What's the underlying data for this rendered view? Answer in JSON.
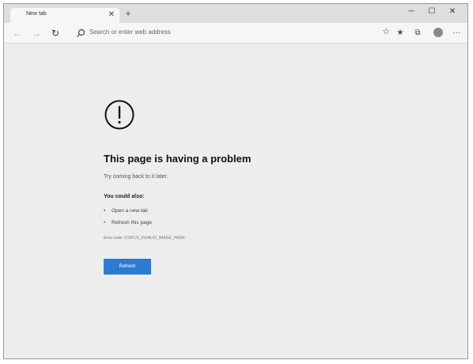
{
  "browser": {
    "tab": {
      "title": "New tab",
      "close_icon": "close-icon"
    },
    "new_tab_icon": "plus-icon",
    "window_controls": {
      "minimize": "─",
      "maximize": "☐",
      "close": "✕"
    },
    "toolbar": {
      "back": "←",
      "forward": "→",
      "reload": "↻",
      "address_placeholder": "Search or enter web address",
      "favorite": "☆",
      "favorites_list": "★",
      "collections": "⧉",
      "more": "···"
    }
  },
  "error_page": {
    "headline": "This page is having a problem",
    "subline": "Try coming back to it later.",
    "try_header": "You could also:",
    "suggestions": [
      "Open a new tab",
      "Refresh this page"
    ],
    "error_code": "Error code: STATUS_INVALID_IMAGE_HASH",
    "refresh_label": "Refresh"
  },
  "colors": {
    "accent": "#2b7bd4",
    "page_background": "#ededed",
    "chrome_background": "#f6f6f6"
  }
}
